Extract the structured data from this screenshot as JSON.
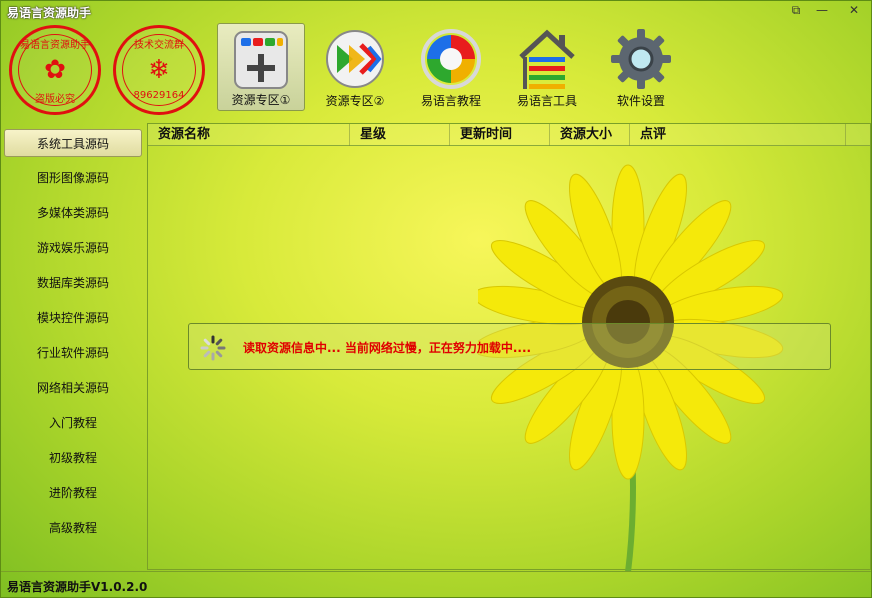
{
  "window": {
    "title": "易语言资源助手"
  },
  "stamps": [
    {
      "top_text": "易语言资源助手",
      "bottom_text": "盗版必究",
      "symbol": "✿"
    },
    {
      "top_text": "技术交流群",
      "bottom_text": "89629164",
      "symbol": "❄"
    }
  ],
  "toolbar": {
    "items": [
      {
        "label": "资源专区①",
        "icon": "plus-grid-icon",
        "active": true
      },
      {
        "label": "资源专区②",
        "icon": "arrow-right-icon",
        "active": false
      },
      {
        "label": "易语言教程",
        "icon": "color-circle-icon",
        "active": false
      },
      {
        "label": "易语言工具",
        "icon": "house-icon",
        "active": false
      },
      {
        "label": "软件设置",
        "icon": "gear-icon",
        "active": false
      }
    ]
  },
  "sidebar": {
    "items": [
      {
        "label": "系统工具源码",
        "selected": true
      },
      {
        "label": "图形图像源码",
        "selected": false
      },
      {
        "label": "多媒体类源码",
        "selected": false
      },
      {
        "label": "游戏娱乐源码",
        "selected": false
      },
      {
        "label": "数据库类源码",
        "selected": false
      },
      {
        "label": "模块控件源码",
        "selected": false
      },
      {
        "label": "行业软件源码",
        "selected": false
      },
      {
        "label": "网络相关源码",
        "selected": false
      },
      {
        "label": "入门教程",
        "selected": false
      },
      {
        "label": "初级教程",
        "selected": false
      },
      {
        "label": "进阶教程",
        "selected": false
      },
      {
        "label": "高级教程",
        "selected": false
      }
    ]
  },
  "table": {
    "columns": [
      "资源名称",
      "星级",
      "更新时间",
      "资源大小",
      "点评"
    ]
  },
  "loading": {
    "message": "读取资源信息中...  当前网络过慢，正在努力加载中...."
  },
  "statusbar": {
    "text": "易语言资源助手V1.0.2.0"
  },
  "colors": {
    "accent_red": "#e00000",
    "stamp_red": "#e01010",
    "background_green": "#a9d42a",
    "flower_yellow": "#f5e90a"
  }
}
